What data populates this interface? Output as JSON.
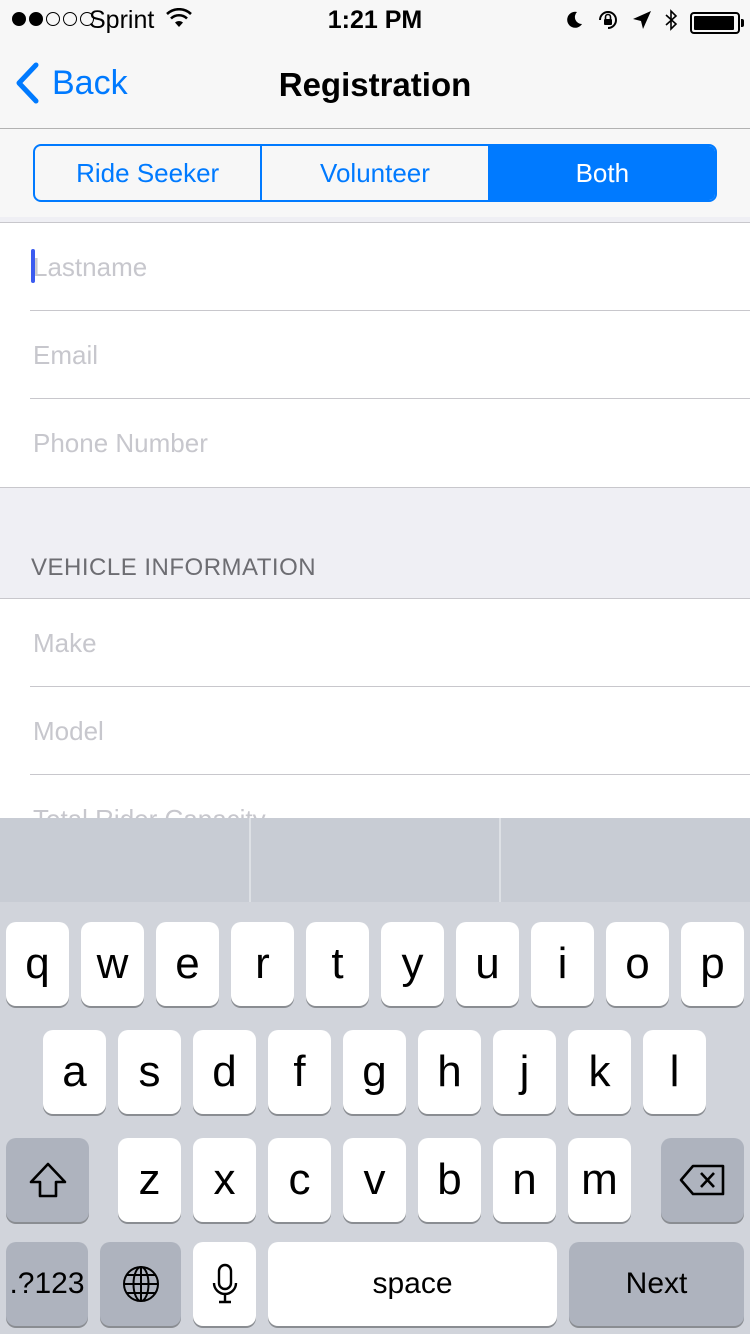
{
  "status_bar": {
    "carrier": "Sprint",
    "time": "1:21 PM",
    "signal_bars_filled": 2,
    "signal_bars_total": 5,
    "battery_level": 0.95,
    "icons": [
      "wifi-icon",
      "moon-icon",
      "orientation-lock-icon",
      "location-arrow-icon",
      "bluetooth-icon",
      "battery-icon"
    ]
  },
  "nav": {
    "back_label": "Back",
    "title": "Registration"
  },
  "segment": {
    "options": [
      "Ride Seeker",
      "Volunteer",
      "Both"
    ],
    "selected": "Both"
  },
  "personal_fields": {
    "lastname": {
      "placeholder": "Lastname",
      "value": ""
    },
    "email": {
      "placeholder": "Email",
      "value": ""
    },
    "phone": {
      "placeholder": "Phone Number",
      "value": ""
    }
  },
  "vehicle_section": {
    "header": "VEHICLE INFORMATION",
    "make": {
      "placeholder": "Make",
      "value": ""
    },
    "model": {
      "placeholder": "Model",
      "value": ""
    },
    "capacity": {
      "placeholder": "Total Rider Capacity",
      "value": ""
    }
  },
  "keyboard": {
    "row1": [
      "q",
      "w",
      "e",
      "r",
      "t",
      "y",
      "u",
      "i",
      "o",
      "p"
    ],
    "row2": [
      "a",
      "s",
      "d",
      "f",
      "g",
      "h",
      "j",
      "k",
      "l"
    ],
    "row3": [
      "z",
      "x",
      "c",
      "v",
      "b",
      "n",
      "m"
    ],
    "numbers_label": ".?123",
    "space_label": "space",
    "return_label": "Next"
  },
  "colors": {
    "accent": "#007aff",
    "placeholder": "#c7c7cd",
    "caret": "#3b5bf0",
    "keyboard_bg": "#d1d4db"
  }
}
